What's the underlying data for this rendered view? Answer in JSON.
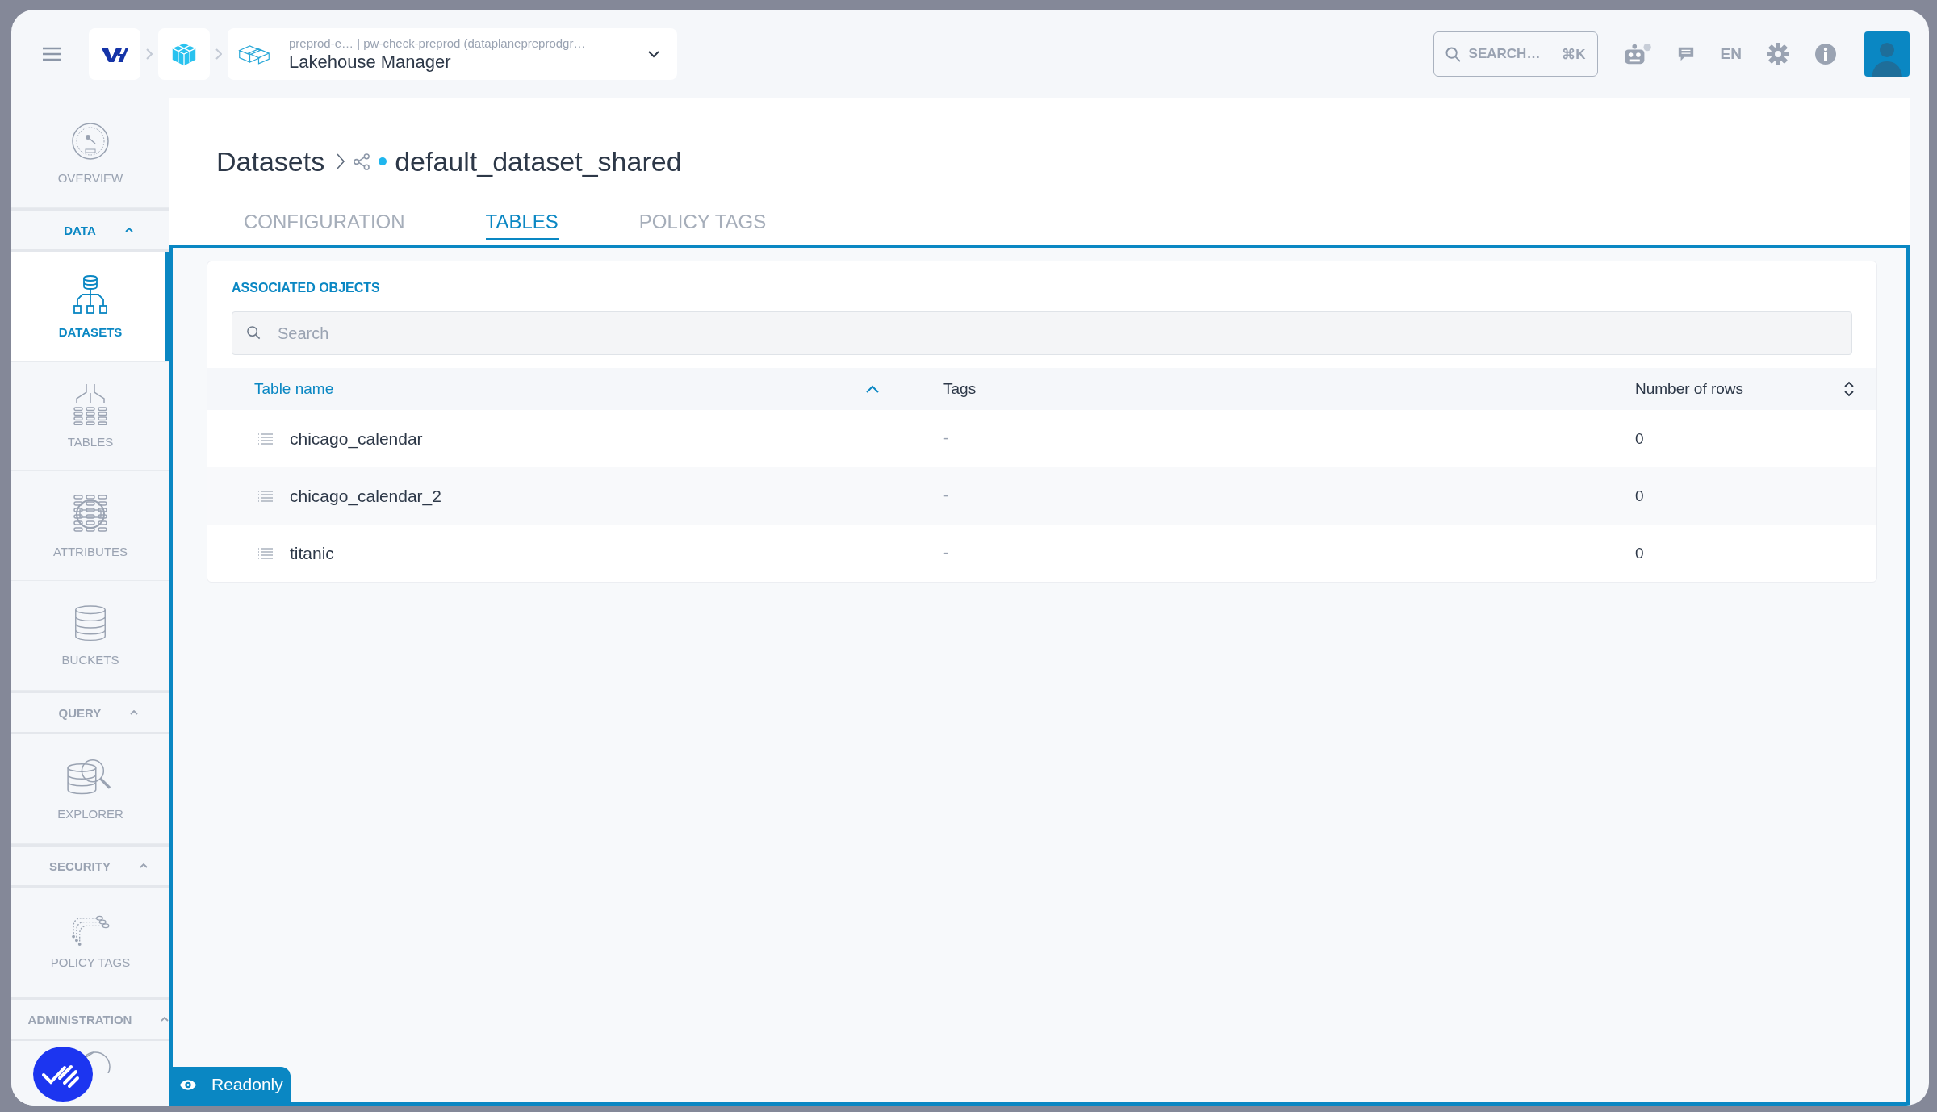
{
  "topbar": {
    "context": "preprod-e… | pw-check-preprod (dataplanepreprodgr…",
    "app_title": "Lakehouse Manager",
    "search": {
      "placeholder": "SEARCH…",
      "shortcut": "⌘K"
    },
    "language": "EN"
  },
  "sidebar": [
    {
      "kind": "item",
      "label": "OVERVIEW",
      "selected": false
    },
    {
      "kind": "section",
      "label": "DATA",
      "expanded": true
    },
    {
      "kind": "item",
      "label": "DATASETS",
      "selected": true
    },
    {
      "kind": "item",
      "label": "TABLES",
      "selected": false
    },
    {
      "kind": "item",
      "label": "ATTRIBUTES",
      "selected": false
    },
    {
      "kind": "item",
      "label": "BUCKETS",
      "selected": false
    },
    {
      "kind": "section",
      "label": "QUERY",
      "expanded": true
    },
    {
      "kind": "item",
      "label": "EXPLORER",
      "selected": false
    },
    {
      "kind": "section",
      "label": "SECURITY",
      "expanded": true
    },
    {
      "kind": "item",
      "label": "POLICY TAGS",
      "selected": false
    },
    {
      "kind": "section",
      "label": "ADMINISTRATION",
      "expanded": true
    },
    {
      "kind": "item",
      "selected": false
    }
  ],
  "breadcrumb": {
    "parent": "Datasets",
    "current": "default_dataset_shared"
  },
  "tabs": [
    {
      "label": "CONFIGURATION",
      "selected": false
    },
    {
      "label": "TABLES",
      "selected": true
    },
    {
      "label": "POLICY TAGS",
      "selected": false
    }
  ],
  "card": {
    "title": "ASSOCIATED OBJECTS",
    "search": {
      "placeholder": "Search"
    },
    "columns": [
      {
        "label": "Table name",
        "sortable": true,
        "sorted": true
      },
      {
        "label": "Tags",
        "sortable": false,
        "sorted": false
      },
      {
        "label": "Number of rows",
        "sortable": true,
        "sorted": false
      }
    ],
    "rows": [
      {
        "name": "chicago_calendar",
        "tags": "-",
        "rows": "0"
      },
      {
        "name": "chicago_calendar_2",
        "tags": "-",
        "rows": "0"
      },
      {
        "name": "titanic",
        "tags": "-",
        "rows": "0"
      }
    ]
  },
  "readonly_badge": "Readonly"
}
